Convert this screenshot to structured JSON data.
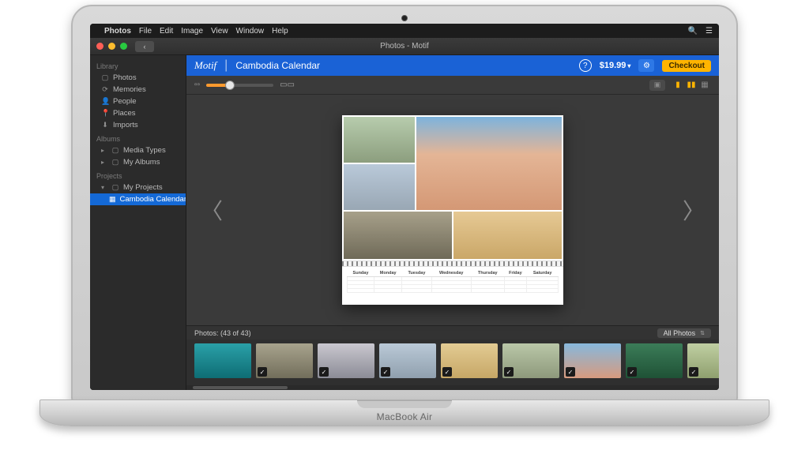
{
  "laptop_brand": "MacBook Air",
  "menubar": {
    "app": "Photos",
    "items": [
      "File",
      "Edit",
      "Image",
      "View",
      "Window",
      "Help"
    ]
  },
  "window": {
    "title": "Photos - Motif"
  },
  "sidebar": {
    "sections": [
      {
        "heading": "Library",
        "items": [
          {
            "icon": "▢",
            "label": "Photos"
          },
          {
            "icon": "⟳",
            "label": "Memories"
          },
          {
            "icon": "👤",
            "label": "People"
          },
          {
            "icon": "📍",
            "label": "Places"
          },
          {
            "icon": "⬇",
            "label": "Imports"
          }
        ]
      },
      {
        "heading": "Albums",
        "items": [
          {
            "disclosure": "▸",
            "icon": "▢",
            "label": "Media Types"
          },
          {
            "disclosure": "▸",
            "icon": "▢",
            "label": "My Albums"
          }
        ]
      },
      {
        "heading": "Projects",
        "items": [
          {
            "disclosure": "▾",
            "icon": "▢",
            "label": "My Projects"
          },
          {
            "indent": true,
            "icon": "▦",
            "label": "Cambodia Calendar",
            "selected": true
          }
        ]
      }
    ]
  },
  "brandbar": {
    "logo": "Motif",
    "project": "Cambodia Calendar",
    "price": "$19.99",
    "checkout": "Checkout"
  },
  "calendar": {
    "days": [
      "Sunday",
      "Monday",
      "Tuesday",
      "Wednesday",
      "Thursday",
      "Friday",
      "Saturday"
    ]
  },
  "tray": {
    "label": "Photos:",
    "count": "(43 of 43)",
    "filter": "All Photos"
  }
}
